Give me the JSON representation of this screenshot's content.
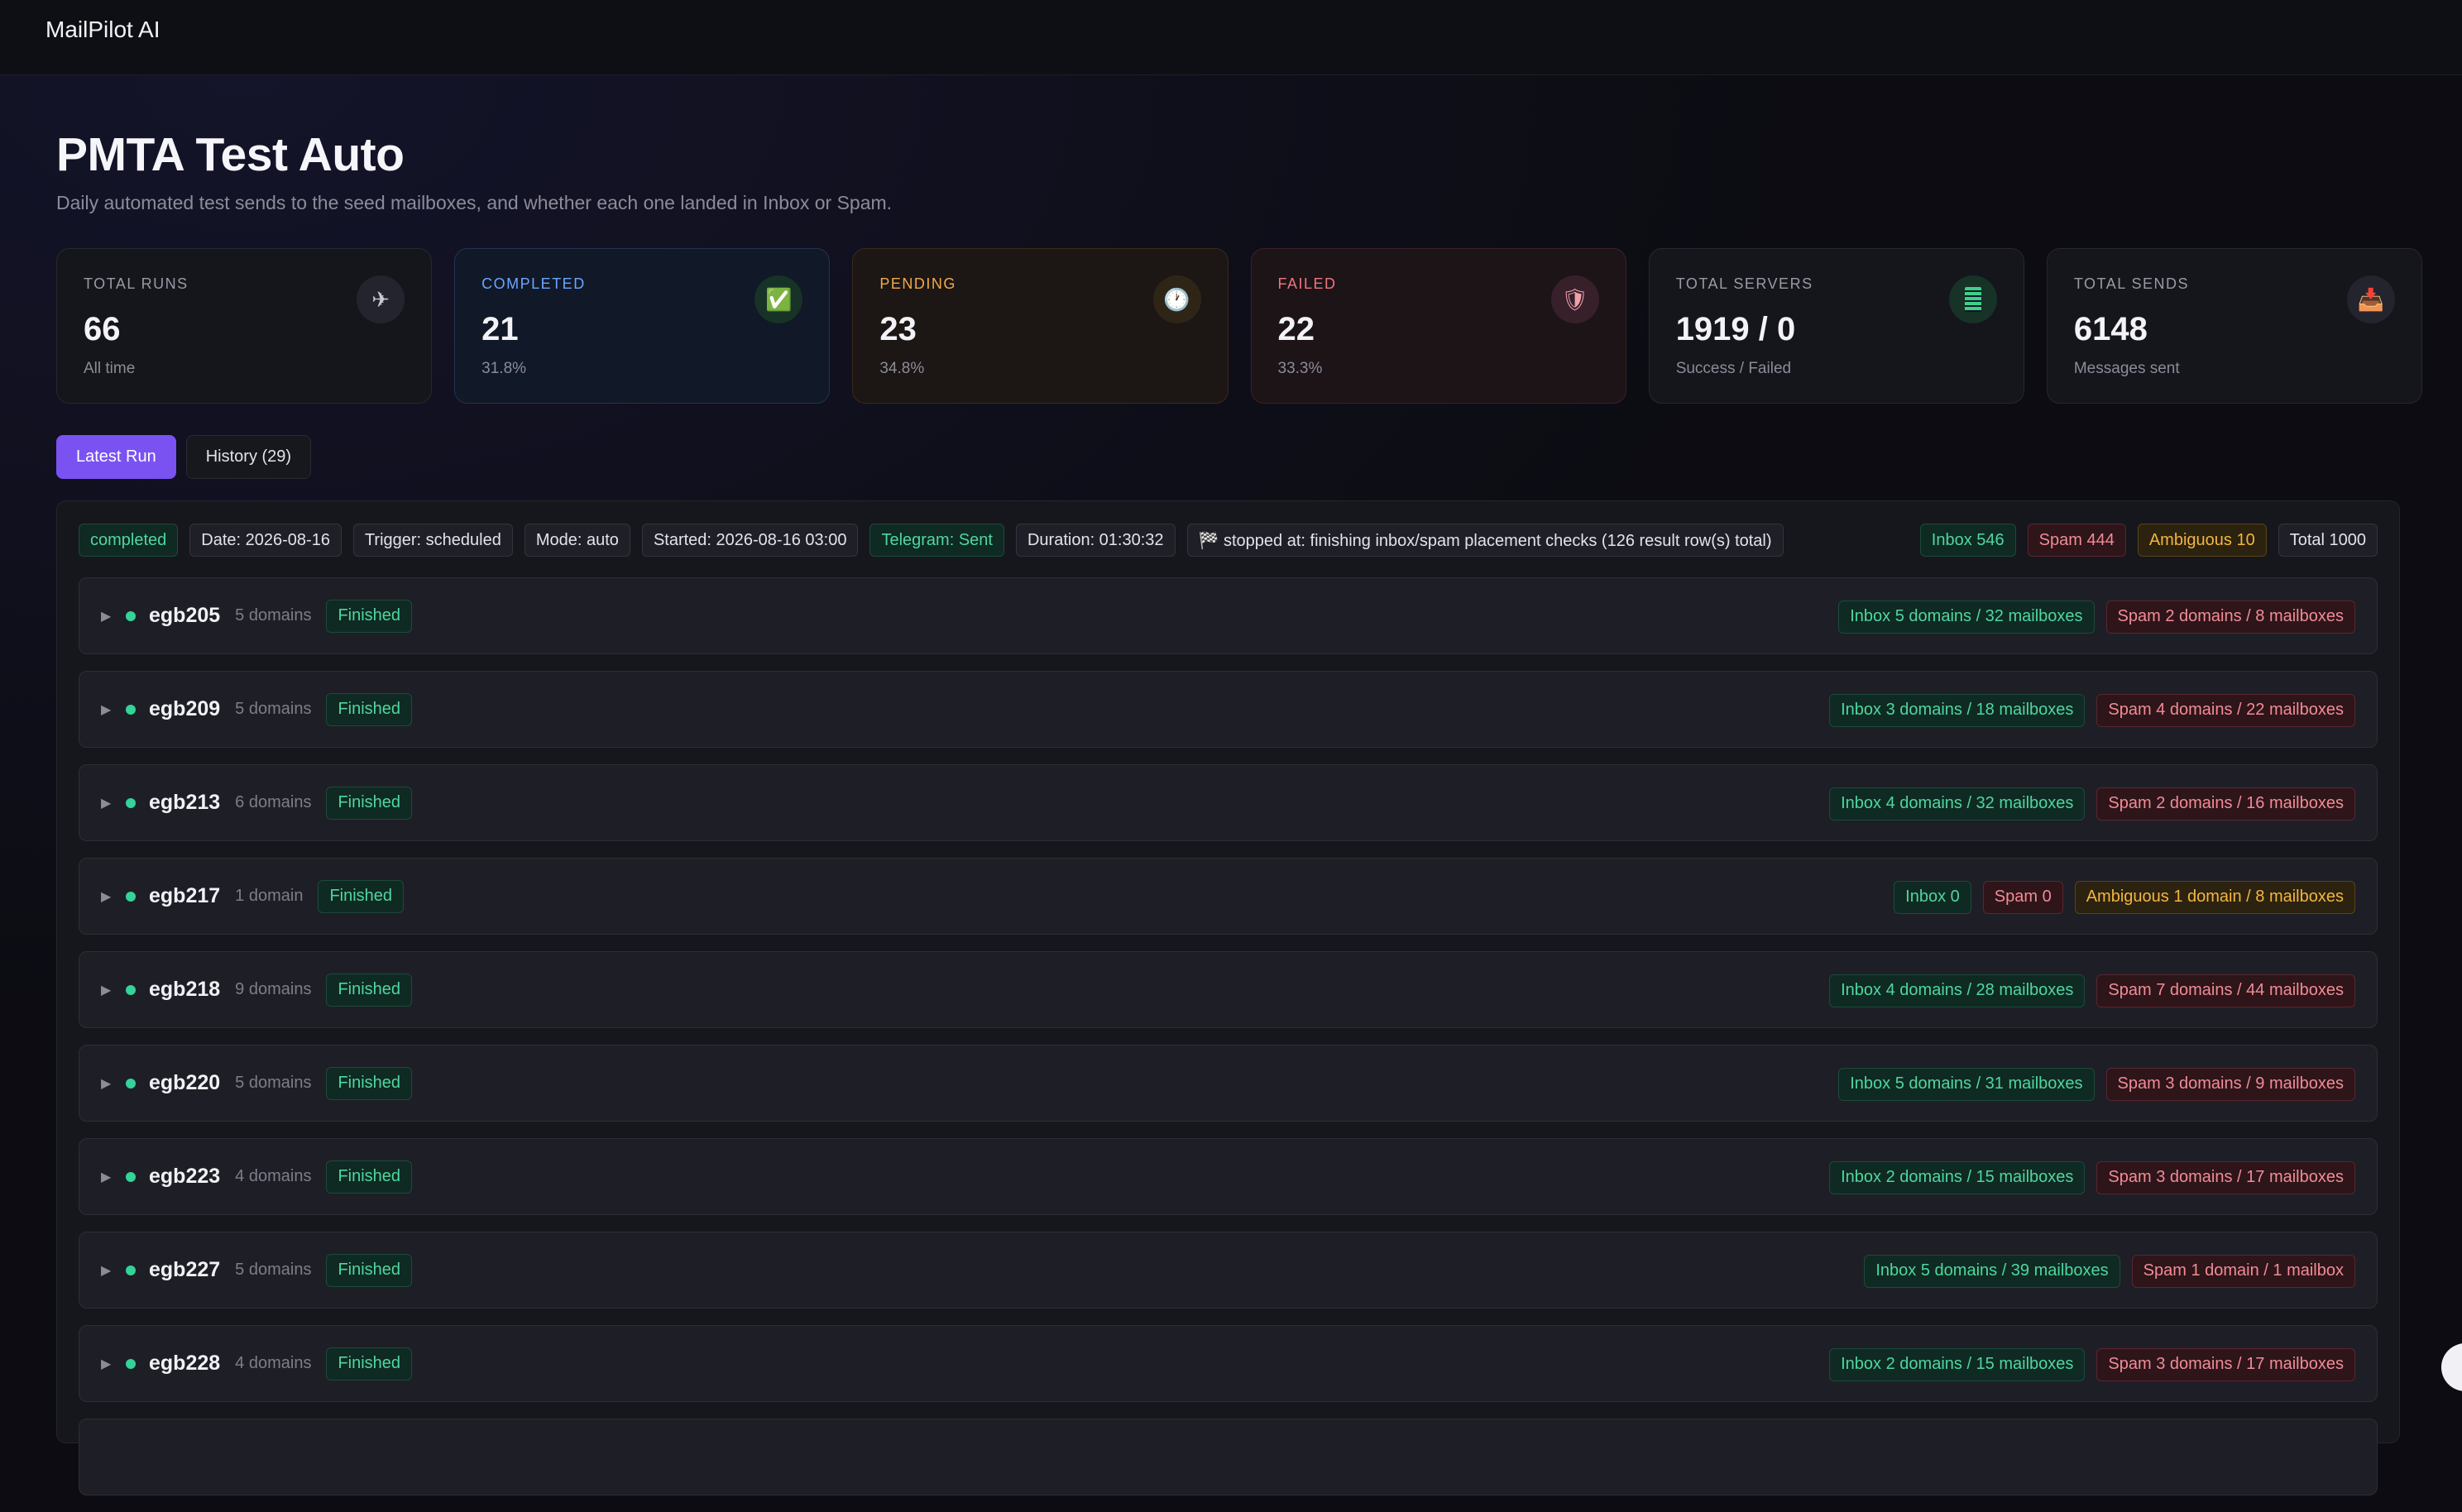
{
  "app": {
    "brand": "MailPilot AI"
  },
  "page": {
    "title": "PMTA Test Auto",
    "subtitle": "Daily automated test sends to the seed mailboxes, and whether each one landed in Inbox or Spam."
  },
  "stats": [
    {
      "label": "TOTAL RUNS",
      "value": "66",
      "foot": "All time",
      "icon": "airplane-icon",
      "glyph": "✈"
    },
    {
      "label": "COMPLETED",
      "value": "21",
      "foot": "31.8%",
      "icon": "check-icon",
      "glyph": "✅"
    },
    {
      "label": "PENDING",
      "value": "23",
      "foot": "34.8%",
      "icon": "clock-icon",
      "glyph": "🕐"
    },
    {
      "label": "FAILED",
      "value": "22",
      "foot": "33.3%",
      "icon": "shield-icon",
      "glyph": "🛡"
    },
    {
      "label": "TOTAL SERVERS",
      "value": "1919 / 0",
      "foot": "Success / Failed",
      "icon": "server-icon",
      "glyph": ""
    },
    {
      "label": "TOTAL SENDS",
      "value": "6148",
      "foot": "Messages sent",
      "icon": "inbox-tray-icon",
      "glyph": "📥"
    }
  ],
  "tabs": {
    "latest": "Latest Run",
    "history": "History (29)"
  },
  "summary": {
    "status": "completed",
    "date": "Date: 2026-08-16",
    "trigger": "Trigger: scheduled",
    "mode": "Mode: auto",
    "started": "Started: 2026-08-16 03:00",
    "telegram": "Telegram: Sent",
    "duration": "Duration: 01:30:32",
    "stopped": "🏁 stopped at: finishing inbox/spam placement checks (126 result row(s) total)",
    "inbox": "Inbox 546",
    "spam": "Spam 444",
    "ambiguous": "Ambiguous 10",
    "total": "Total 1000"
  },
  "rows": [
    {
      "name": "egb205",
      "domains": "5 domains",
      "status": "Finished",
      "inbox": "Inbox 5 domains / 32 mailboxes",
      "spam": "Spam 2 domains / 8 mailboxes"
    },
    {
      "name": "egb209",
      "domains": "5 domains",
      "status": "Finished",
      "inbox": "Inbox 3 domains / 18 mailboxes",
      "spam": "Spam 4 domains / 22 mailboxes"
    },
    {
      "name": "egb213",
      "domains": "6 domains",
      "status": "Finished",
      "inbox": "Inbox 4 domains / 32 mailboxes",
      "spam": "Spam 2 domains / 16 mailboxes"
    },
    {
      "name": "egb217",
      "domains": "1 domain",
      "status": "Finished",
      "inbox": "Inbox 0",
      "spam": "Spam 0",
      "ambiguous": "Ambiguous 1 domain / 8 mailboxes"
    },
    {
      "name": "egb218",
      "domains": "9 domains",
      "status": "Finished",
      "inbox": "Inbox 4 domains / 28 mailboxes",
      "spam": "Spam 7 domains / 44 mailboxes"
    },
    {
      "name": "egb220",
      "domains": "5 domains",
      "status": "Finished",
      "inbox": "Inbox 5 domains / 31 mailboxes",
      "spam": "Spam 3 domains / 9 mailboxes"
    },
    {
      "name": "egb223",
      "domains": "4 domains",
      "status": "Finished",
      "inbox": "Inbox 2 domains / 15 mailboxes",
      "spam": "Spam 3 domains / 17 mailboxes"
    },
    {
      "name": "egb227",
      "domains": "5 domains",
      "status": "Finished",
      "inbox": "Inbox 5 domains / 39 mailboxes",
      "spam": "Spam 1 domain / 1 mailbox"
    },
    {
      "name": "egb228",
      "domains": "4 domains",
      "status": "Finished",
      "inbox": "Inbox 2 domains / 15 mailboxes",
      "spam": "Spam 3 domains / 17 mailboxes"
    },
    {
      "name": "",
      "domains": "",
      "status": "",
      "inbox": "",
      "spam": ""
    }
  ]
}
